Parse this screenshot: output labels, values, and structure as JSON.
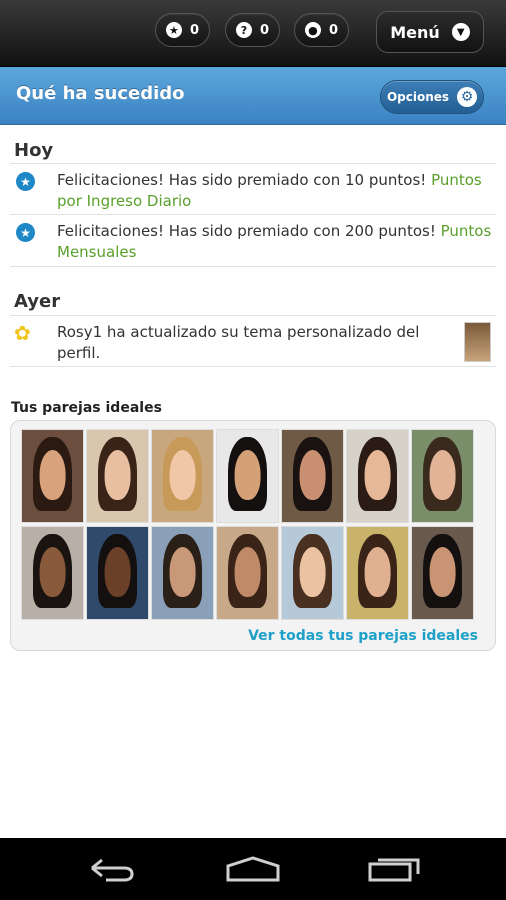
{
  "topbar": {
    "counters": [
      {
        "icon": "star-icon",
        "glyph": "★",
        "value": "0"
      },
      {
        "icon": "question-icon",
        "glyph": "?",
        "value": "0"
      },
      {
        "icon": "person-icon",
        "glyph": "●",
        "value": "0"
      }
    ],
    "menu_label": "Menú"
  },
  "section": {
    "title": "Qué ha sucedido",
    "options_label": "Opciones"
  },
  "feed": {
    "today_label": "Hoy",
    "yesterday_label": "Ayer",
    "today_items": [
      {
        "text": "Felicitaciones! Has sido premiado con 10 puntos! ",
        "link": "Puntos por Ingreso Diario"
      },
      {
        "text": "Felicitaciones! Has sido premiado con 200 puntos! ",
        "link": "Puntos Mensuales"
      }
    ],
    "yesterday_items": [
      {
        "text": "Rosy1  ha actualizado su tema personalizado del perfil."
      }
    ]
  },
  "matches": {
    "title": "Tus parejas ideales",
    "see_all": "Ver todas tus parejas ideales",
    "photo_count": 14
  },
  "colors": {
    "header_blue": "#4a94d0",
    "link_green": "#5aa02c",
    "link_cyan": "#1ea0c8"
  }
}
